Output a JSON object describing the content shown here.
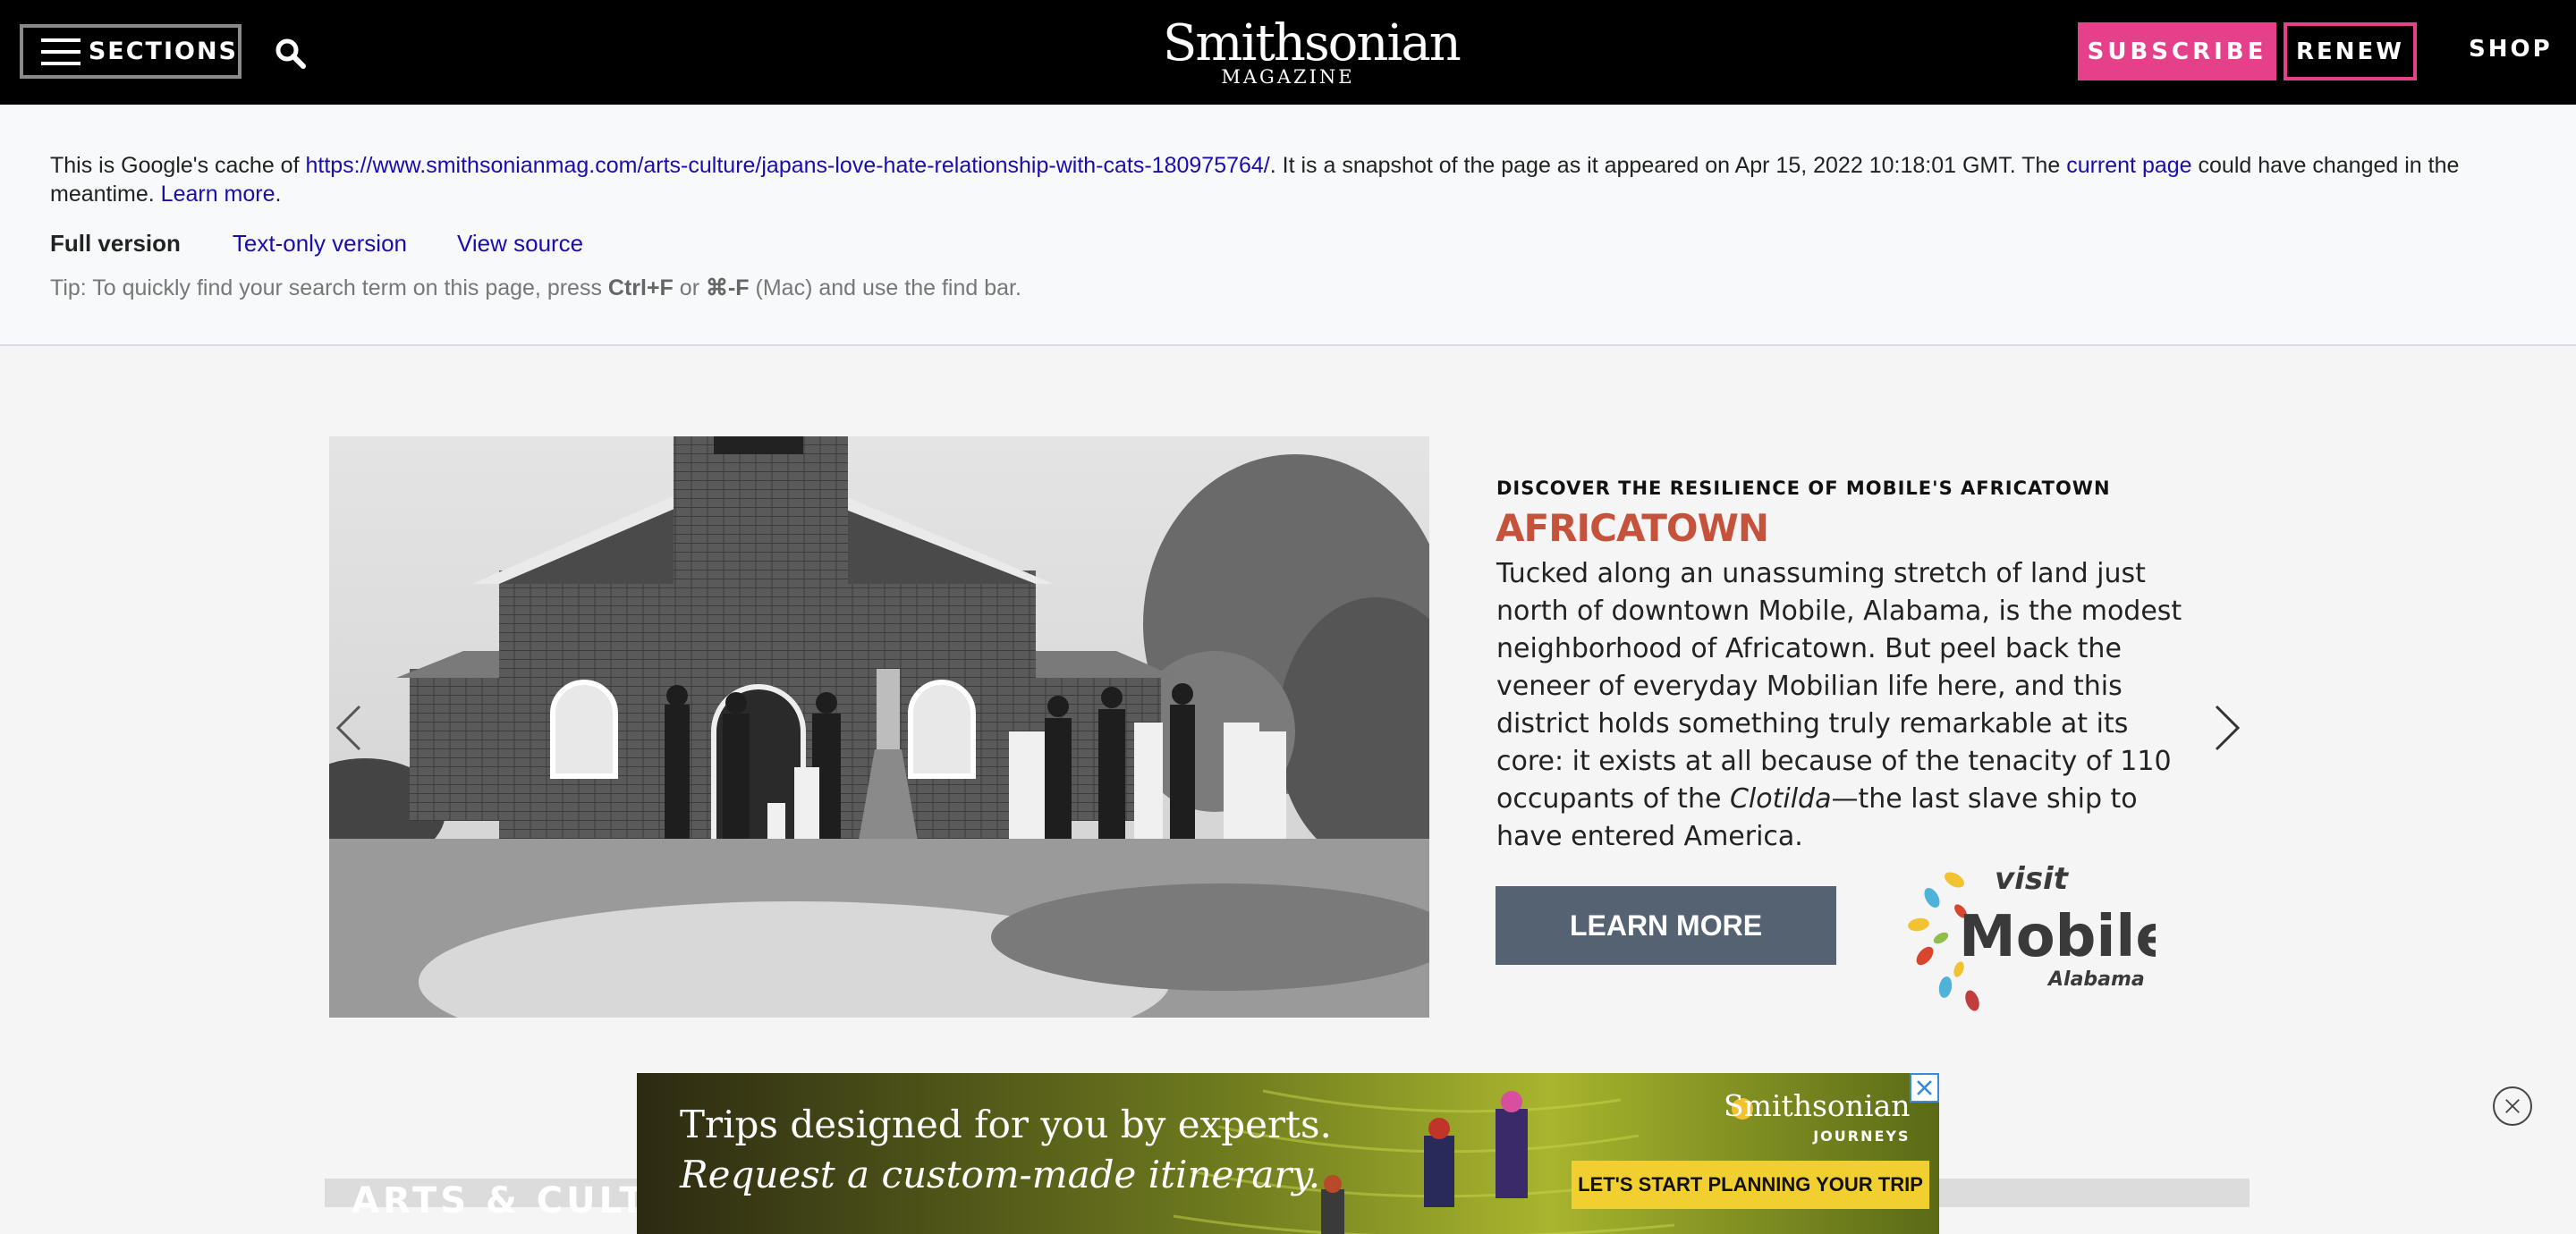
{
  "nav": {
    "sections_label": "SECTIONS",
    "logo_main": "Smithsonian",
    "logo_sub": "MAGAZINE",
    "subscribe_label": "SUBSCRIBE",
    "renew_label": "RENEW",
    "shop_label": "SHOP",
    "accent_color": "#e5408a"
  },
  "cache": {
    "prefix": "This is Google's cache of ",
    "url": "https://www.smithsonianmag.com/arts-culture/japans-love-hate-relationship-with-cats-180975764/",
    "middle": ". It is a snapshot of the page as it appeared on Apr 15, 2022 10:18:01 GMT. The ",
    "current_page": "current page",
    "suffix": " could have changed in the meantime. ",
    "learn_more": "Learn more",
    "full_version": "Full version",
    "text_only": "Text-only version",
    "view_source": "View source",
    "tip_prefix": "Tip: To quickly find your search term on this page, press ",
    "tip_key1": "Ctrl+F",
    "tip_or": " or ",
    "tip_key2": "⌘-F",
    "tip_suffix": " (Mac) and use the find bar."
  },
  "ad": {
    "kicker": "DISCOVER THE RESILIENCE OF MOBILE'S AFRICATOWN",
    "title": "AFRICATOWN",
    "body_1": "Tucked along an unassuming stretch of land just north of downtown Mobile, Alabama, is the modest neighborhood of Africatown. But peel back the veneer of everyday Mobilian life here, and this district holds something truly remarkable at its core: it exists at all because of the tenacity of 110 occupants of the ",
    "body_italic": "Clotilda",
    "body_2": "—the last slave ship to have entered America.",
    "cta": "LEARN MORE",
    "logo_visit": "visit",
    "logo_mobile": "Mobile",
    "logo_alabama": "Alabama",
    "title_color": "#c5523a"
  },
  "section": {
    "label": "ARTS & CULTURE"
  },
  "banner": {
    "line1": "Trips designed for you by experts.",
    "line2": "Request a custom-made itinerary.",
    "brand": "Smithsonian",
    "brand_sub": "JOURNEYS",
    "cta": "LET'S START PLANNING YOUR TRIP"
  }
}
